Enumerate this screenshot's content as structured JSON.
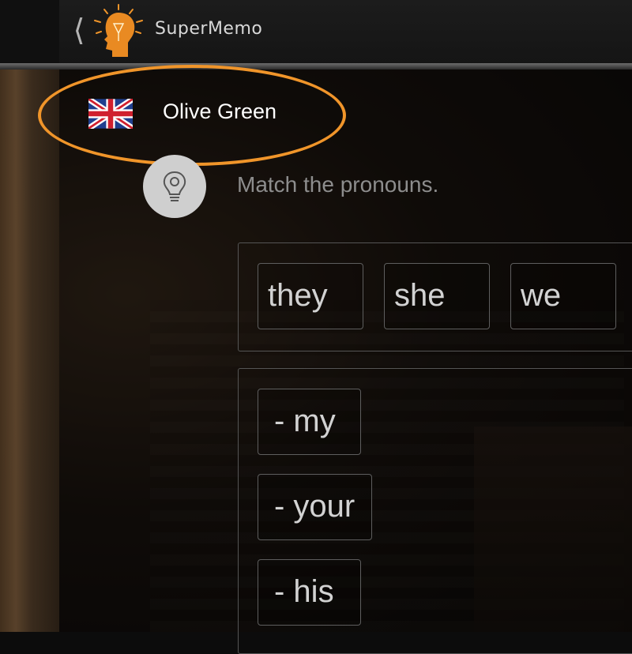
{
  "header": {
    "back_icon": "chevron-left-icon",
    "brand": "SuperMemo"
  },
  "user": {
    "name": "Olive Green",
    "flag_icon": "uk-flag-icon",
    "highlight_color": "#f0952a"
  },
  "exercise": {
    "hint_icon": "lightbulb-icon",
    "instruction": "Match the pronouns.",
    "words": [
      "they",
      "she",
      "we"
    ],
    "targets": [
      "- my",
      "- your",
      "- his"
    ]
  }
}
